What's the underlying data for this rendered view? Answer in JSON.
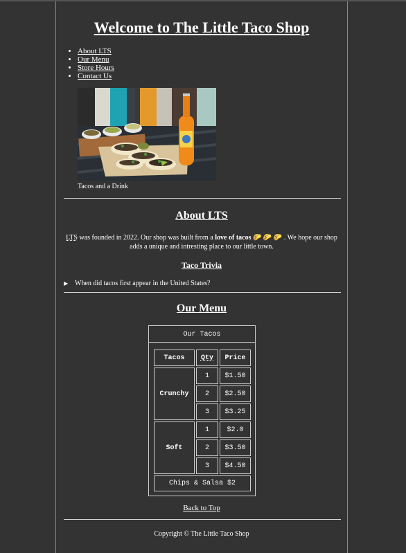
{
  "title": "Welcome to The Little Taco Shop",
  "nav": [
    {
      "label": "About LTS"
    },
    {
      "label": "Our Menu"
    },
    {
      "label": "Store Hours"
    },
    {
      "label": "Contact Us"
    }
  ],
  "photo": {
    "caption": "Tacos and a Drink"
  },
  "about": {
    "heading": "About LTS",
    "abbr": "LTS",
    "text_1": " was founded in 2022. Our shop was built from a ",
    "strong": "love of tacos",
    "emoji": " 🌮 🌮 🌮 ",
    "text_2": ". We hope our shop adds a unique and intresting place to our little town.",
    "trivia_heading": "Taco Trivia",
    "trivia_question": "When did tacos first appear in the United States?"
  },
  "menu": {
    "heading": "Our Menu",
    "caption": "Our Tacos",
    "headers": [
      "Tacos",
      "Qty",
      "Price"
    ],
    "groups": [
      {
        "name": "Crunchy",
        "rows": [
          {
            "qty": "1",
            "price": "$1.50"
          },
          {
            "qty": "2",
            "price": "$2.50"
          },
          {
            "qty": "3",
            "price": "$3.25"
          }
        ]
      },
      {
        "name": "Soft",
        "rows": [
          {
            "qty": "1",
            "price": "$2.0"
          },
          {
            "qty": "2",
            "price": "$3.50"
          },
          {
            "qty": "3",
            "price": "$4.50"
          }
        ]
      }
    ],
    "footer": "Chips & Salsa $2"
  },
  "back_to_top": "Back to Top",
  "copyright": "Copyright © The Little Taco Shop"
}
